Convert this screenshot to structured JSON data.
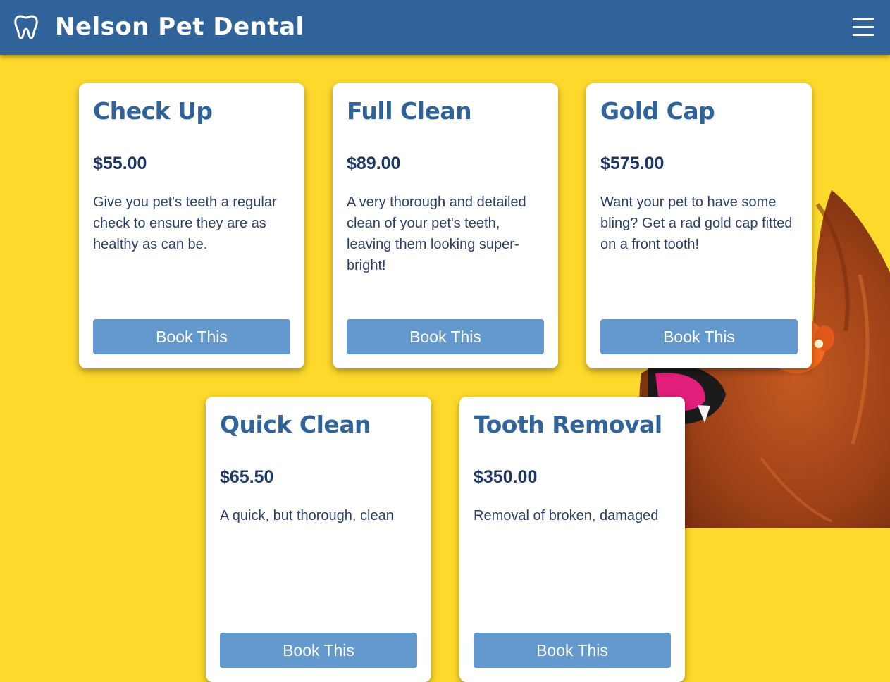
{
  "navbar": {
    "brand": "Nelson Pet Dental",
    "logo_icon": "tooth-icon",
    "menu_icon": "hamburger-menu-icon",
    "background": "#2f6399"
  },
  "page": {
    "background": "#fdd92b"
  },
  "services": [
    {
      "title": "Check Up",
      "price": "$55.00",
      "description": "Give you pet's teeth a regular check to ensure they are as healthy as can be.",
      "button": "Book This"
    },
    {
      "title": "Full Clean",
      "price": "$89.00",
      "description": "A very thorough and detailed clean of your pet's teeth, leaving them looking super-bright!",
      "button": "Book This"
    },
    {
      "title": "Gold Cap",
      "price": "$575.00",
      "description": "Want your pet to have some bling? Get a rad gold cap fitted on a front tooth!",
      "button": "Book This"
    },
    {
      "title": "Quick Clean",
      "price": "$65.50",
      "description": "A quick, but thorough, clean",
      "button": "Book This"
    },
    {
      "title": "Tooth Removal",
      "price": "$350.00",
      "description": "Removal of broken, damaged",
      "button": "Book This"
    }
  ],
  "colors": {
    "accent": "#2f6399",
    "button": "#6399cc",
    "price": "#1f3763"
  }
}
